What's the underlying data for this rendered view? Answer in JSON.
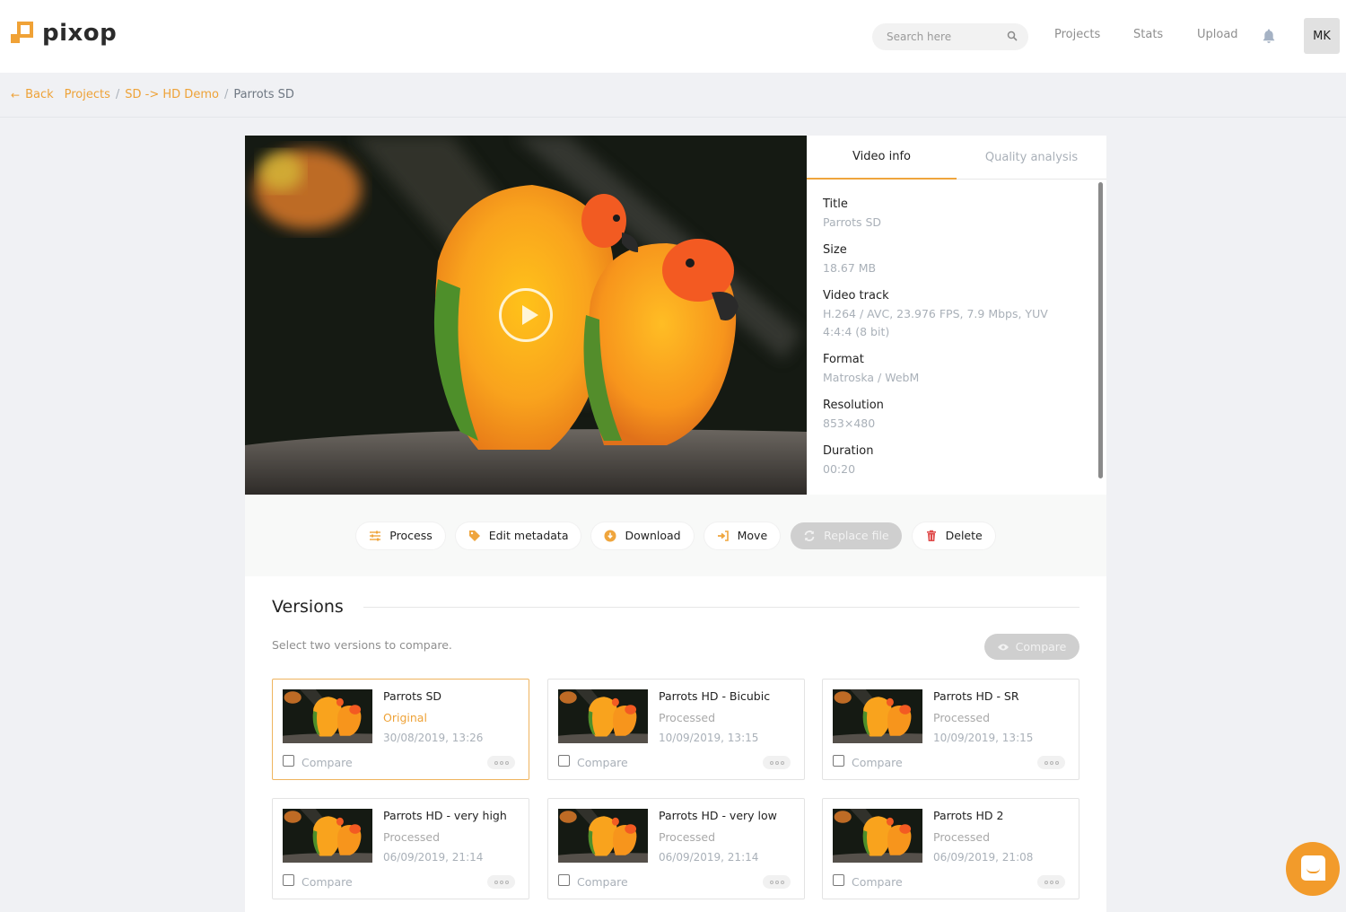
{
  "brand": {
    "name": "pixop",
    "accent": "#f0a236"
  },
  "header": {
    "search_placeholder": "Search here",
    "nav": [
      "Projects",
      "Stats",
      "Upload"
    ],
    "avatar_initials": "MK"
  },
  "breadcrumb": {
    "back_label": "Back",
    "items": [
      "Projects",
      "SD -> HD Demo"
    ],
    "current": "Parrots SD",
    "separator": "/"
  },
  "video_info": {
    "tabs": [
      "Video info",
      "Quality analysis"
    ],
    "active_tab": "Video info",
    "fields": [
      {
        "label": "Title",
        "value": "Parrots SD"
      },
      {
        "label": "Size",
        "value": "18.67 MB"
      },
      {
        "label": "Video track",
        "value": "H.264 / AVC, 23.976 FPS, 7.9 Mbps, YUV 4:4:4 (8 bit)"
      },
      {
        "label": "Format",
        "value": "Matroska / WebM"
      },
      {
        "label": "Resolution",
        "value": "853×480"
      },
      {
        "label": "Duration",
        "value": "00:20"
      }
    ]
  },
  "actions": {
    "process": "Process",
    "edit_metadata": "Edit metadata",
    "download": "Download",
    "move": "Move",
    "replace_file": "Replace file",
    "delete": "Delete"
  },
  "versions": {
    "title": "Versions",
    "hint": "Select two versions to compare.",
    "compare_button": "Compare",
    "compare_checkbox_label": "Compare",
    "items": [
      {
        "title": "Parrots SD",
        "status": "Original",
        "date": "30/08/2019, 13:26",
        "selected": true
      },
      {
        "title": "Parrots HD - Bicubic",
        "status": "Processed",
        "date": "10/09/2019, 13:15",
        "selected": false
      },
      {
        "title": "Parrots HD - SR",
        "status": "Processed",
        "date": "10/09/2019, 13:15",
        "selected": false
      },
      {
        "title": "Parrots HD - very high",
        "status": "Processed",
        "date": "06/09/2019, 21:14",
        "selected": false
      },
      {
        "title": "Parrots HD - very low",
        "status": "Processed",
        "date": "06/09/2019, 21:14",
        "selected": false
      },
      {
        "title": "Parrots HD 2",
        "status": "Processed",
        "date": "06/09/2019, 21:08",
        "selected": false
      }
    ]
  }
}
